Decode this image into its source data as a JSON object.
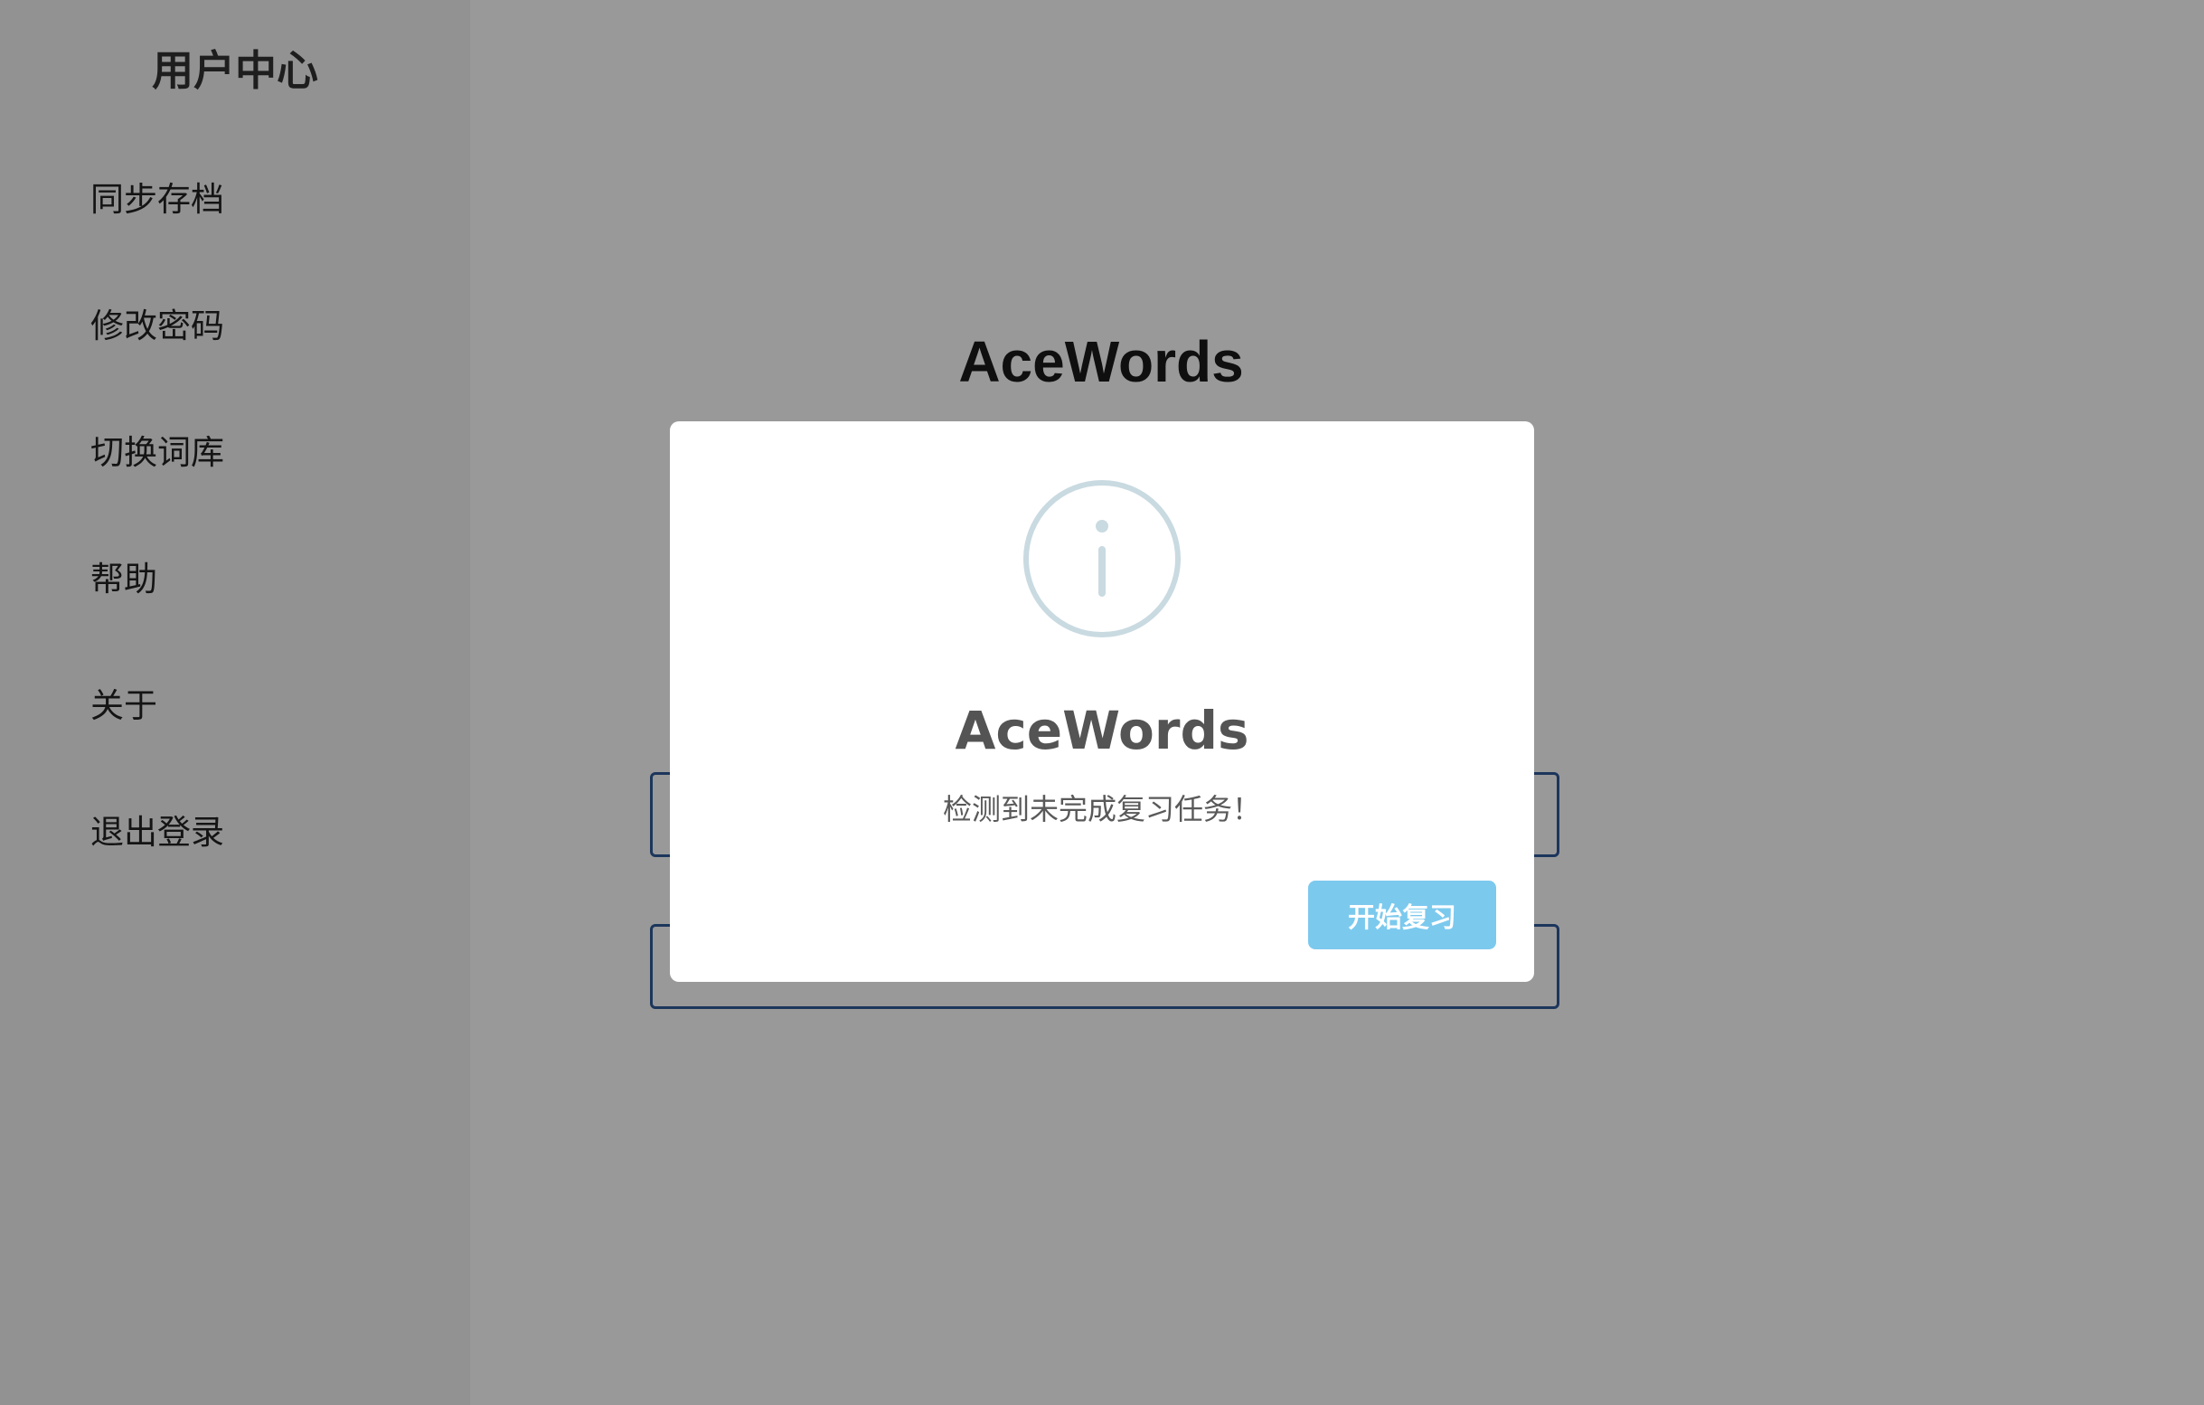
{
  "sidebar": {
    "title": "用户中心",
    "items": [
      {
        "label": "同步存档"
      },
      {
        "label": "修改密码"
      },
      {
        "label": "切换词库"
      },
      {
        "label": "帮助"
      },
      {
        "label": "关于"
      },
      {
        "label": "退出登录"
      }
    ]
  },
  "main": {
    "title": "AceWords"
  },
  "modal": {
    "icon": "info-icon",
    "title": "AceWords",
    "message": "检测到未完成复习任务！",
    "confirm_label": "开始复习"
  },
  "colors": {
    "modal_button": "#7cc9ee",
    "info_icon": "#c9dae1",
    "main_button_border": "#2f5a9a"
  }
}
